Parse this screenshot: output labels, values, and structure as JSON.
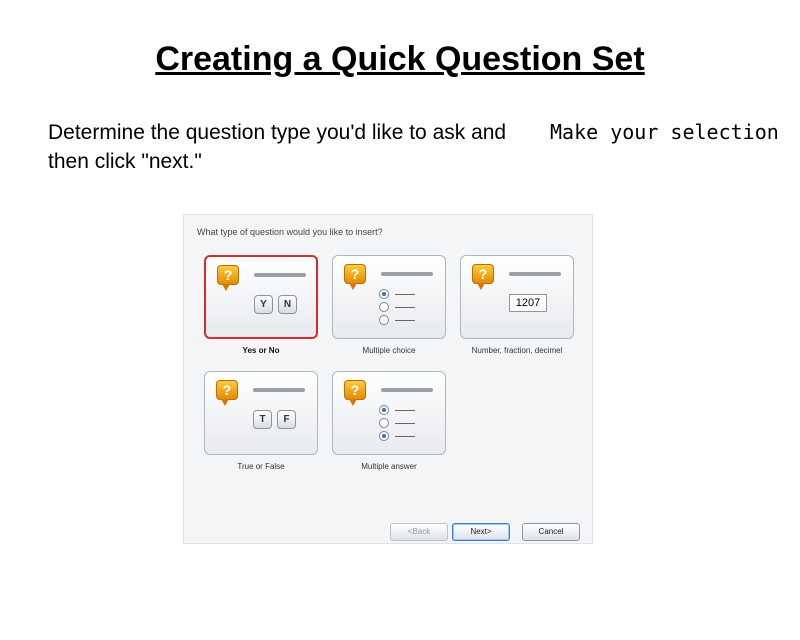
{
  "slide": {
    "title": "Creating a Quick Question Set",
    "intro": "Determine the question type you'd like to ask and then click \"next.\"",
    "note": "Make your selection"
  },
  "dialog": {
    "prompt": "What type of question would you like to insert?",
    "tiles": [
      {
        "label": "Yes or No",
        "selected": true,
        "icon": "question-bubble-icon",
        "keys": [
          "Y",
          "N"
        ]
      },
      {
        "label": "Multiple choice",
        "selected": false,
        "icon": "question-bubble-icon"
      },
      {
        "label": "Number, fraction, decimel",
        "selected": false,
        "icon": "question-bubble-icon",
        "example_value": "1207"
      },
      {
        "label": "True or False",
        "selected": false,
        "icon": "question-bubble-icon",
        "keys": [
          "T",
          "F"
        ]
      },
      {
        "label": "Multiple answer",
        "selected": false,
        "icon": "question-bubble-icon"
      }
    ],
    "buttons": {
      "back": "<Back",
      "next": "Next>",
      "cancel": "Cancel"
    }
  },
  "colors": {
    "selected_border": "#d82b2b",
    "icon": "#f5a300",
    "radio_fill": "#2f6fcf"
  }
}
